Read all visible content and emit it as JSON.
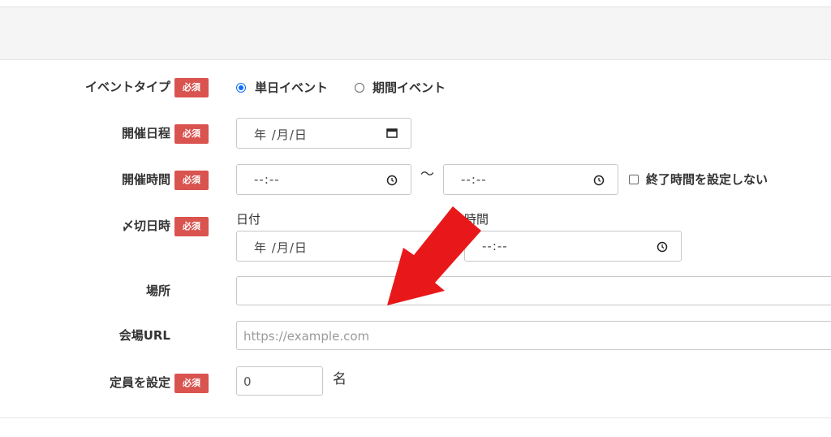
{
  "form": {
    "required_badge": "必須",
    "event_type": {
      "label": "イベントタイプ",
      "options": [
        {
          "text": "単日イベント",
          "selected": true
        },
        {
          "text": "期間イベント",
          "selected": false
        }
      ]
    },
    "event_date": {
      "label": "開催日程",
      "value": "年 /月/日",
      "icon": "calendar-icon"
    },
    "event_time": {
      "label": "開催時間",
      "start_value": "--:--",
      "separator": "〜",
      "end_value": "--:--",
      "no_end_checkbox": {
        "text": "終了時間を設定しない",
        "checked": false
      },
      "icon": "clock-icon"
    },
    "deadline": {
      "label": "〆切日時",
      "date_caption": "日付",
      "date_value": "年 /月/日",
      "time_caption": "時間",
      "time_value": "--:--"
    },
    "venue": {
      "label": "場所",
      "value": ""
    },
    "venue_url": {
      "label": "会場URL",
      "placeholder": "https://example.com"
    },
    "capacity": {
      "label": "定員を設定",
      "value": "0",
      "unit": "名"
    }
  },
  "colors": {
    "badge": "#d9534f",
    "radio_accent": "#0d6efd",
    "arrow": "#e8181a",
    "header_band": "#f5f5f5"
  }
}
